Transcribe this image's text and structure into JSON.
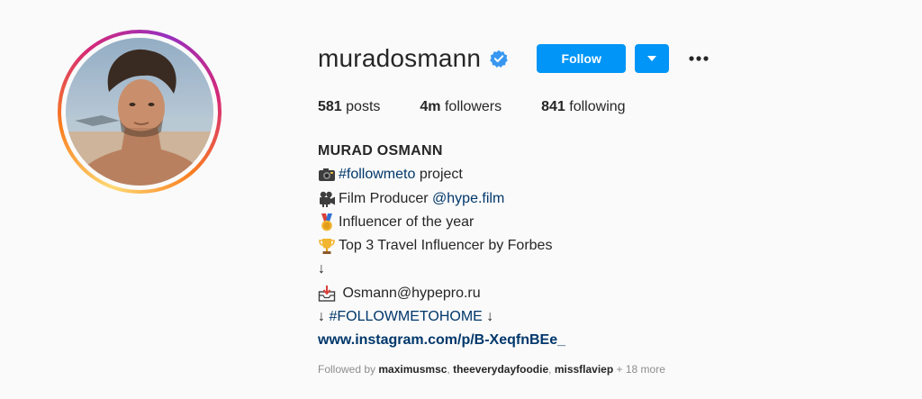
{
  "profile": {
    "username": "muradosmann",
    "follow_label": "Follow",
    "stats": {
      "posts_count": "581",
      "posts_label": "posts",
      "followers_count": "4m",
      "followers_label": "followers",
      "following_count": "841",
      "following_label": "following"
    },
    "bio": {
      "name": "MURAD OSMANN",
      "line1_hashtag": "#followmeto",
      "line1_text": " project",
      "line2_text": "Film Producer ",
      "line2_mention": "@hype.film",
      "line3_text": "Influencer of the year",
      "line4_text": "Top 3 Travel Influencer by Forbes",
      "line5_arrow": "↓",
      "line6_text": " Osmann@hypepro.ru",
      "line7_pre": "↓ ",
      "line7_hashtag": "#FOLLOWMETOHOME",
      "line7_post": " ↓",
      "url": "www.instagram.com/p/B-XeqfnBEe_"
    },
    "followed_by": {
      "prefix": "Followed by ",
      "user1": "maximusmsc",
      "sep1": ", ",
      "user2": "theeverydayfoodie",
      "sep2": ", ",
      "user3": "missflaviep",
      "suffix": " + 18 more"
    }
  },
  "icons": {
    "verified": "verified-badge-icon",
    "dropdown": "caret-down-icon",
    "more": "more-options-icon"
  },
  "colors": {
    "primary_button": "#0095f6",
    "link": "#00376b",
    "muted": "#8e8e8e",
    "text": "#262626",
    "background": "#fafafa"
  }
}
